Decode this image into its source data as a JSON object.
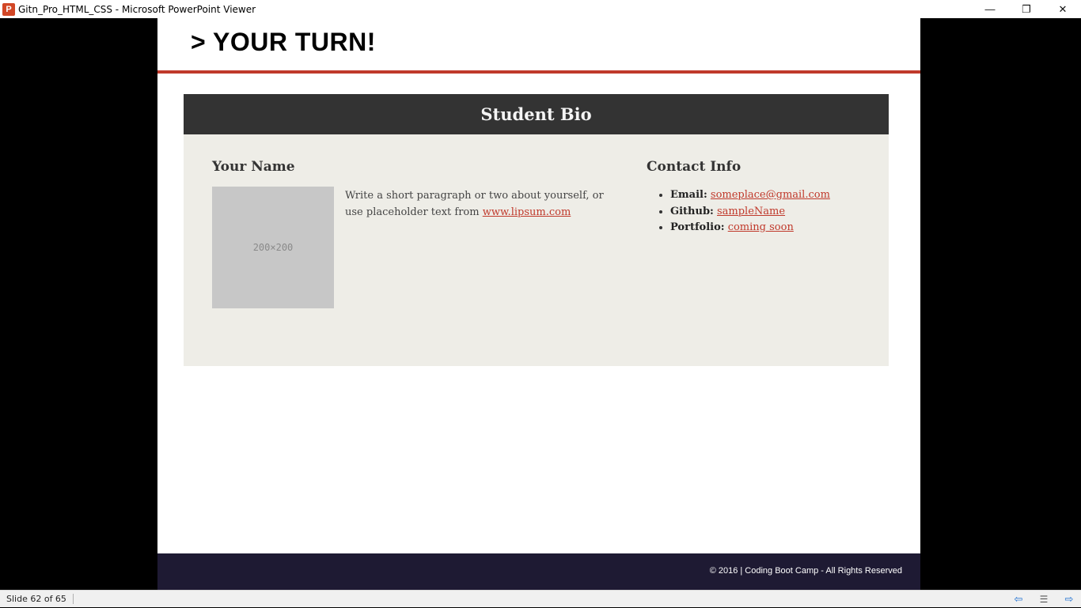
{
  "window": {
    "app_icon_letter": "P",
    "title": "Gitn_Pro_HTML_CSS - Microsoft PowerPoint Viewer",
    "minimize_symbol": "—",
    "restore_symbol": "❐",
    "close_symbol": "✕"
  },
  "slide": {
    "title": "> YOUR TURN!",
    "accent_color": "#c0392b",
    "bio": {
      "header": "Student Bio",
      "name_heading": "Your Name",
      "image_label": "200×200",
      "paragraph_text": "Write a short paragraph or two about yourself, or use placeholder text from ",
      "paragraph_link": "www.lipsum.com",
      "contact_heading": "Contact Info",
      "contacts": [
        {
          "label": "Email:",
          "value": "someplace@gmail.com"
        },
        {
          "label": "Github:",
          "value": "sampleName"
        },
        {
          "label": "Portfolio:",
          "value": "coming soon"
        }
      ]
    },
    "footer": "© 2016 | Coding Boot Camp - All Rights Reserved"
  },
  "statusbar": {
    "slide_counter": "Slide 62 of 65",
    "prev_icon": "prev-arrow-icon",
    "menu_icon": "slide-menu-icon",
    "next_icon": "next-arrow-icon"
  }
}
